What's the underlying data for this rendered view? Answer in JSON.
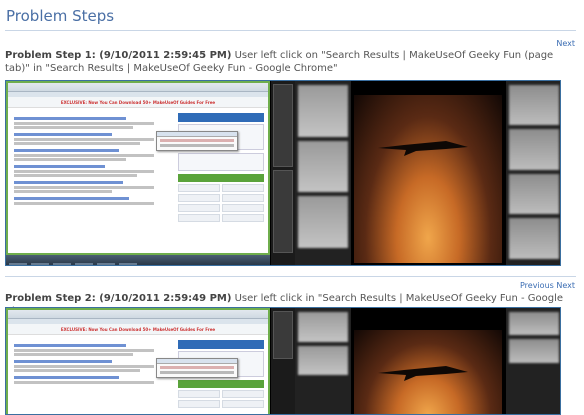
{
  "page": {
    "title": "Problem Steps"
  },
  "nav": {
    "next_label": "Next",
    "previous_label": "Previous"
  },
  "steps": [
    {
      "header_bold": "Problem Step 1: (9/10/2011 2:59:45 PM)",
      "header_text": " User left click on \"Search Results | MakeUseOf Geeky Fun (page tab)\" in \"Search Results | MakeUseOf Geeky Fun - Google Chrome\""
    },
    {
      "header_bold": "Problem Step 2: (9/10/2011 2:59:49 PM)",
      "header_text": " User left click in \"Search Results | MakeUseOf Geeky Fun - Google Chrome\""
    }
  ],
  "screenshot": {
    "banner_text": "EXCLUSIVE: Now You Can Download 50+ MakeUseOf Guides For Free",
    "colors": {
      "accent": "#6fae4c",
      "link": "#3b6db3",
      "title": "#4a6fa5"
    }
  }
}
